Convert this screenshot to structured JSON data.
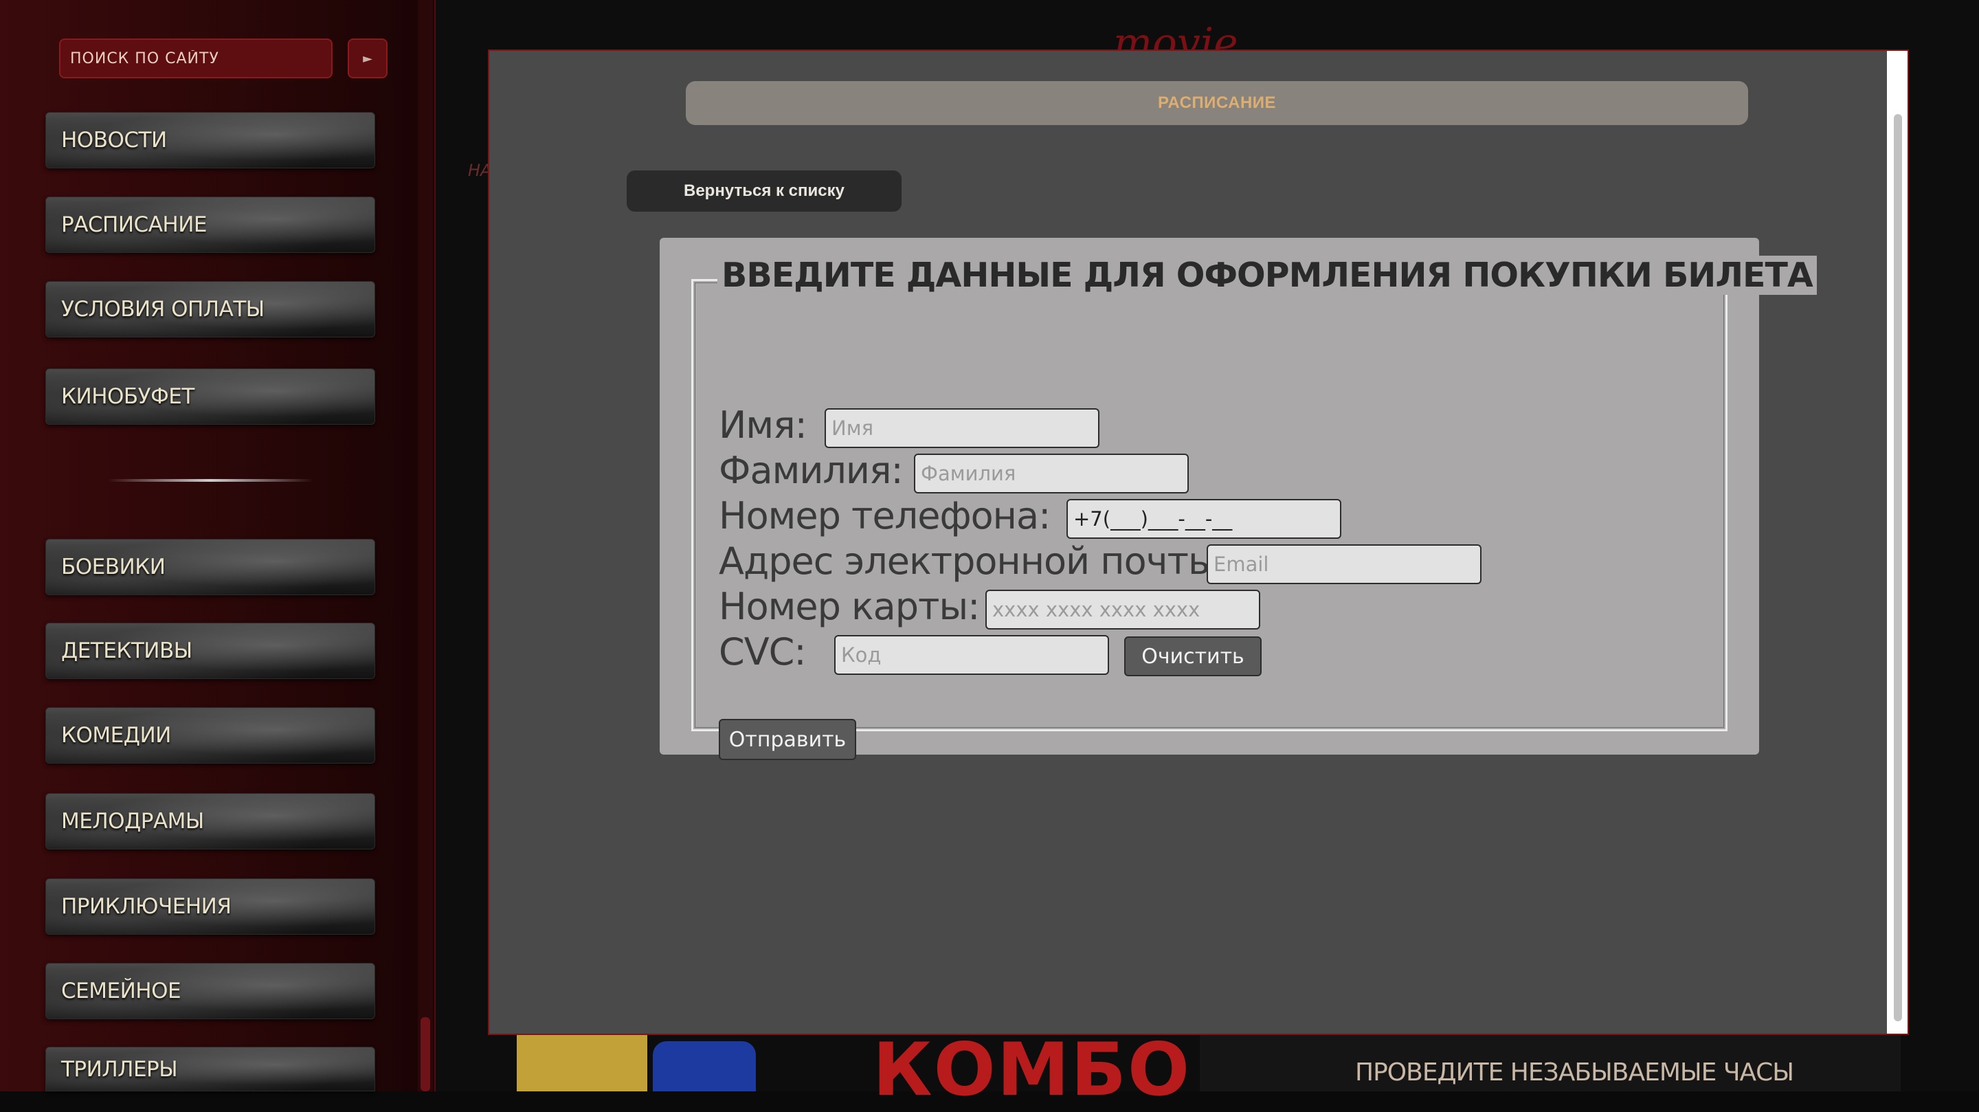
{
  "sidebar": {
    "search_placeholder": "ПОИСК ПО САЙТУ",
    "search_button_icon": "►",
    "menu": [
      {
        "label": "НОВОСТИ"
      },
      {
        "label": "РАСПИСАНИЕ"
      },
      {
        "label": "УСЛОВИЯ ОПЛАТЫ"
      },
      {
        "label": "КИНОБУФЕТ"
      }
    ],
    "genres": [
      {
        "label": "БОЕВИКИ"
      },
      {
        "label": "ДЕТЕКТИВЫ"
      },
      {
        "label": "КОМЕДИИ"
      },
      {
        "label": "МЕЛОДРАМЫ"
      },
      {
        "label": "ПРИКЛЮЧЕНИЯ"
      },
      {
        "label": "СЕМЕЙНОЕ"
      },
      {
        "label": "ТРИЛЛЕРЫ"
      }
    ]
  },
  "background": {
    "brand": "movie",
    "breadcrumb": "НА",
    "combo": "КОМБО",
    "promo": "ПРОВЕДИТЕ НЕЗАБЫВАЕМЫЕ ЧАСЫ"
  },
  "modal": {
    "schedule_tab": "РАСПИСАНИЕ",
    "back_button": "Вернуться к списку",
    "form": {
      "legend": "ВВЕДИТЕ ДАННЫЕ ДЛЯ ОФОРМЛЕНИЯ ПОКУПКИ БИЛЕТА",
      "name_label": "Имя:",
      "name_placeholder": "Имя",
      "surname_label": "Фамилия:",
      "surname_placeholder": "Фамилия",
      "phone_label": "Номер телефона:",
      "phone_value": "+7(___)___-__-__",
      "email_label": "Адрес электронной почты:",
      "email_placeholder": "Email",
      "card_label": "Номер карты:",
      "card_placeholder": "xxxx xxxx xxxx xxxx",
      "cvc_label": "CVC:",
      "cvc_placeholder": "Код",
      "clear_button": "Очистить",
      "submit_button": "Отправить"
    }
  },
  "colors": {
    "sidebar_bg": "#2a0708",
    "accent_red": "#7a1518",
    "modal_bg": "#4a4a4a",
    "form_bg": "#aaa8a8",
    "schedule_text": "#dcae72"
  }
}
